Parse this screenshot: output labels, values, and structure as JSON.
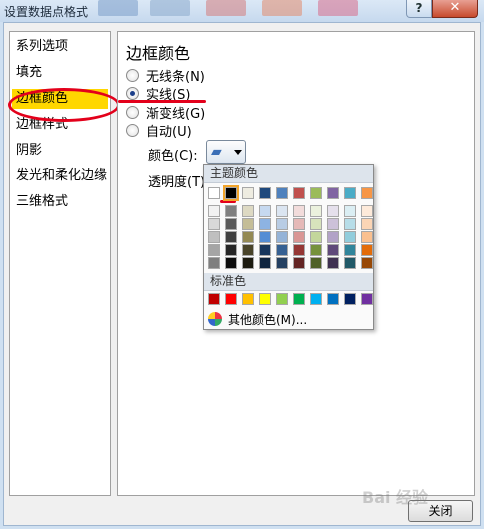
{
  "window": {
    "title": "设置数据点格式",
    "help_label": "?",
    "close_label": "✕"
  },
  "nav": {
    "items": [
      {
        "label": "系列选项",
        "selected": false
      },
      {
        "label": "填充",
        "selected": false
      },
      {
        "label": "边框颜色",
        "selected": true
      },
      {
        "label": "边框样式",
        "selected": false
      },
      {
        "label": "阴影",
        "selected": false
      },
      {
        "label": "发光和柔化边缘",
        "selected": false
      },
      {
        "label": "三维格式",
        "selected": false
      }
    ]
  },
  "panel": {
    "title": "边框颜色",
    "options": [
      {
        "label": "无线条(N)",
        "checked": false
      },
      {
        "label": "实线(S)",
        "checked": true
      },
      {
        "label": "渐变线(G)",
        "checked": false
      },
      {
        "label": "自动(U)",
        "checked": false
      }
    ],
    "color_label": "颜色(C):",
    "transparency_label": "透明度(T):"
  },
  "palette": {
    "theme_title": "主题颜色",
    "standard_title": "标准色",
    "more_colors_label": "其他颜色(M)...",
    "theme_row": [
      "#ffffff",
      "#000000",
      "#eeece1",
      "#1f497d",
      "#4f81bd",
      "#c0504d",
      "#9bbb59",
      "#8064a2",
      "#4bacc6",
      "#f79646"
    ],
    "shade_columns": [
      [
        "#f2f2f2",
        "#d8d8d8",
        "#bfbfbf",
        "#a5a5a5",
        "#7f7f7f"
      ],
      [
        "#7f7f7f",
        "#595959",
        "#3f3f3f",
        "#262626",
        "#0c0c0c"
      ],
      [
        "#ddd9c3",
        "#c4bd97",
        "#938953",
        "#494429",
        "#1d1b10"
      ],
      [
        "#c6d9f0",
        "#8db3e2",
        "#548dd4",
        "#17365d",
        "#0f243e"
      ],
      [
        "#dbe5f1",
        "#b8cce4",
        "#95b3d7",
        "#366092",
        "#244061"
      ],
      [
        "#f2dcdb",
        "#e5b9b7",
        "#d99694",
        "#953734",
        "#632423"
      ],
      [
        "#ebf1dd",
        "#d7e3bc",
        "#c3d69b",
        "#76923c",
        "#4f6128"
      ],
      [
        "#e5e0ec",
        "#ccc1d9",
        "#b2a2c7",
        "#5f497a",
        "#3f3151"
      ],
      [
        "#dbeef3",
        "#b7dde8",
        "#92cddc",
        "#31859b",
        "#205867"
      ],
      [
        "#fdeada",
        "#fbd5b5",
        "#fac08f",
        "#e36c09",
        "#974806"
      ]
    ],
    "standard_colors": [
      "#c00000",
      "#ff0000",
      "#ffc000",
      "#ffff00",
      "#92d050",
      "#00b050",
      "#00b0f0",
      "#0070c0",
      "#002060",
      "#7030a0"
    ],
    "selected_theme_color": "#000000"
  },
  "footer": {
    "close_label": "关闭"
  },
  "watermark": "Bai 经验"
}
